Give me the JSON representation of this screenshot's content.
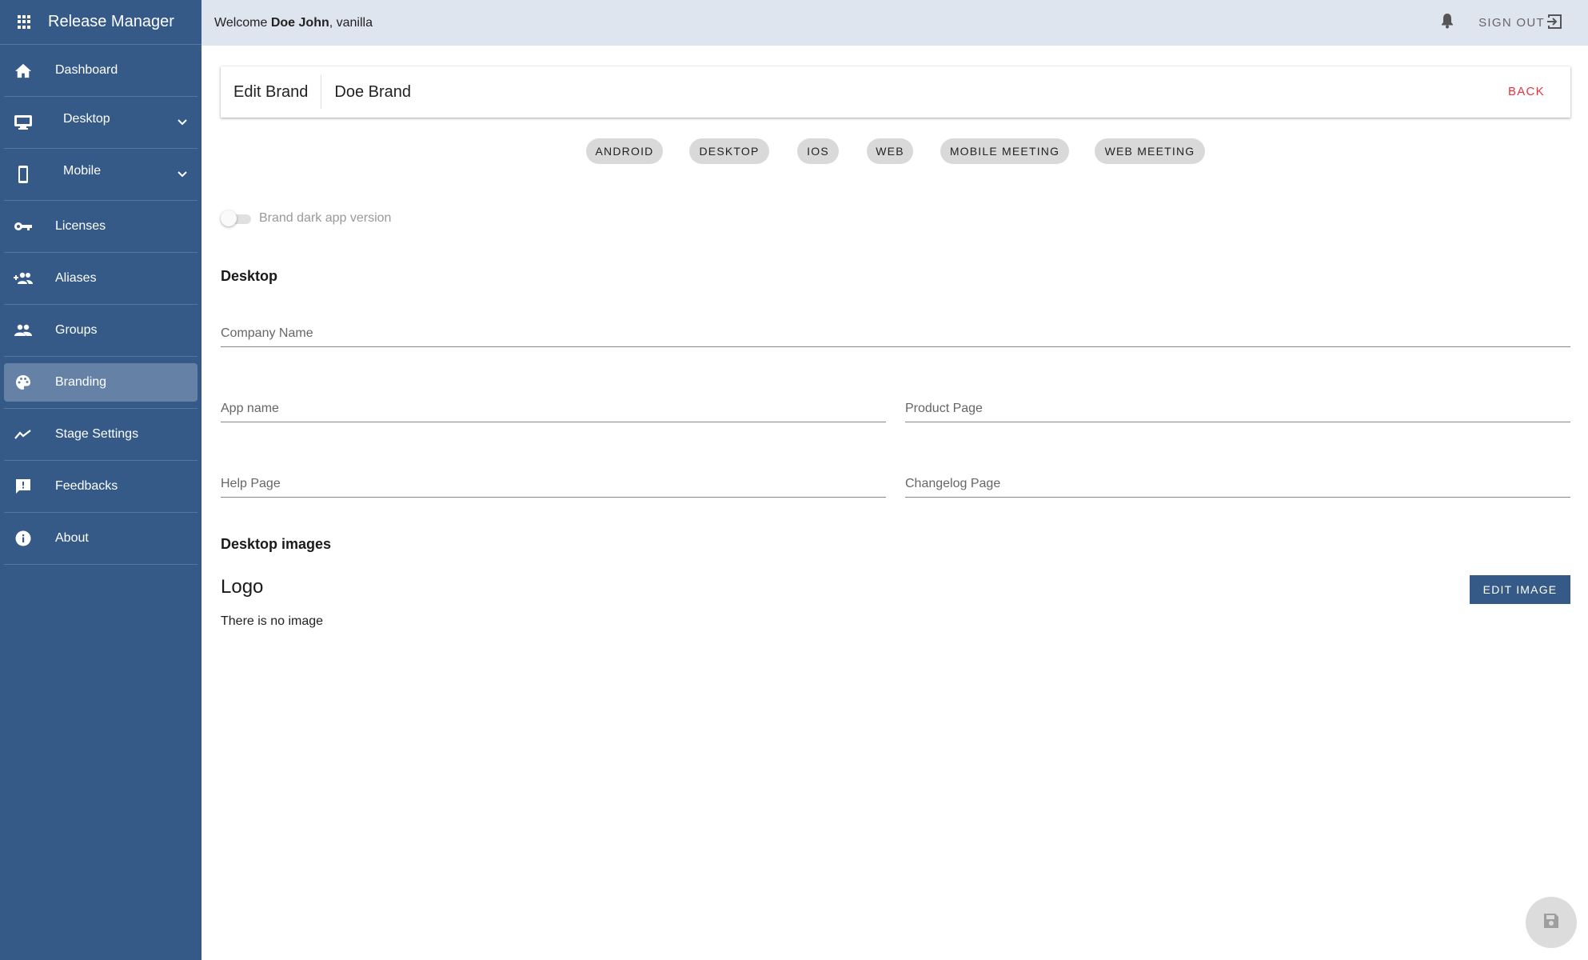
{
  "app": {
    "title": "Release Manager"
  },
  "sidebar": {
    "items": [
      {
        "label": "Dashboard",
        "icon": "home-icon"
      },
      {
        "label": "Desktop",
        "icon": "desktop-icon",
        "expandable": true
      },
      {
        "label": "Mobile",
        "icon": "mobile-icon",
        "expandable": true
      },
      {
        "label": "Licenses",
        "icon": "key-icon"
      },
      {
        "label": "Aliases",
        "icon": "add-group-icon"
      },
      {
        "label": "Groups",
        "icon": "people-icon"
      },
      {
        "label": "Branding",
        "icon": "palette-icon",
        "active": true
      },
      {
        "label": "Stage Settings",
        "icon": "trending-icon"
      },
      {
        "label": "Feedbacks",
        "icon": "feedback-icon"
      },
      {
        "label": "About",
        "icon": "info-icon"
      }
    ]
  },
  "topbar": {
    "welcome_prefix": "Welcome ",
    "user_name": "Doe John",
    "welcome_suffix": ", vanilla",
    "signout_label": "SIGN OUT"
  },
  "header_card": {
    "title": "Edit Brand",
    "brand_name": "Doe Brand",
    "back_label": "BACK",
    "back_color": "#e8333c"
  },
  "platform_chips": [
    "ANDROID",
    "DESKTOP",
    "IOS",
    "WEB",
    "MOBILE MEETING",
    "WEB MEETING"
  ],
  "dark_toggle": {
    "label": "Brand dark app version",
    "checked": false
  },
  "desktop_section": {
    "heading": "Desktop",
    "fields": {
      "company_name": {
        "label": "Company Name",
        "value": ""
      },
      "app_name": {
        "label": "App name",
        "value": ""
      },
      "product_page": {
        "label": "Product Page",
        "value": ""
      },
      "help_page": {
        "label": "Help Page",
        "value": ""
      },
      "changelog_page": {
        "label": "Changelog Page",
        "value": ""
      }
    }
  },
  "images_section": {
    "heading": "Desktop images",
    "logo_title": "Logo",
    "empty_text": "There is no image",
    "edit_button": "EDIT IMAGE"
  },
  "colors": {
    "sidebar": "#355a87",
    "sidebar_active": "#6582a6",
    "topbar": "#dfe5ee",
    "primary": "#355a87"
  }
}
